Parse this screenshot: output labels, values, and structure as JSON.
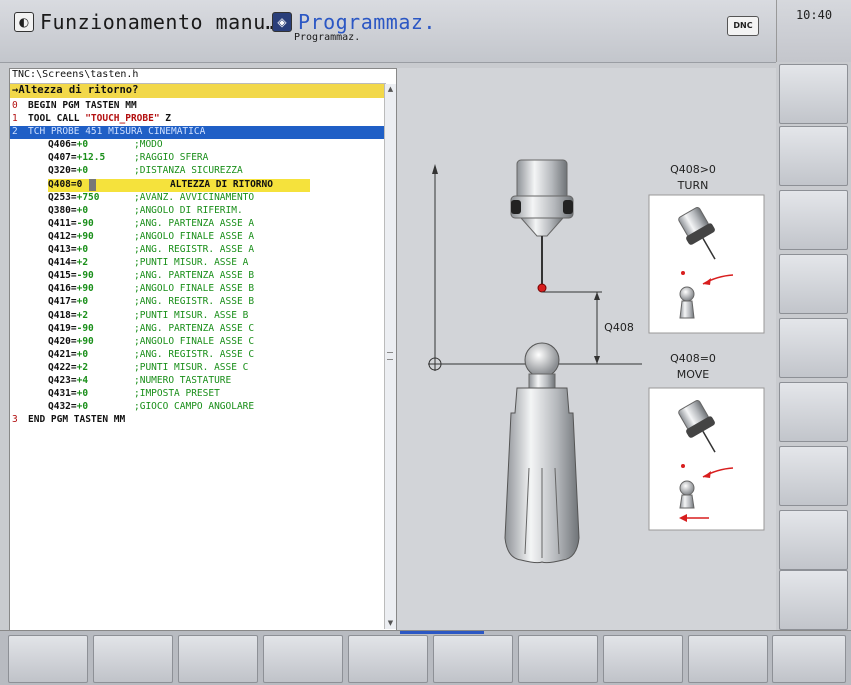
{
  "header": {
    "mode_left_title": "Funzionamento manu…",
    "mode_right_title": "Programmaz.",
    "mode_right_subtitle": "Programmaz.",
    "dnc_label": "DNC",
    "clock": "10:40"
  },
  "editor": {
    "path": "TNC:\\Screens\\tasten.h",
    "prompt": "→Altezza di ritorno?",
    "lines": [
      {
        "num": "0",
        "code": "BEGIN PGM TASTEN MM"
      },
      {
        "num": "1",
        "code": "TOOL CALL ",
        "string": "\"TOUCH_PROBE\"",
        "tail": " Z"
      },
      {
        "num": "2",
        "code": "TCH PROBE 451 MISURA CINEMATICA"
      },
      {
        "param": "Q406=+0",
        "comment": ";MODO"
      },
      {
        "param": "Q407=+12.5",
        "comment": ";RAGGIO SFERA"
      },
      {
        "param": "Q320=+0",
        "comment": ";DISTANZA SICUREZZA"
      },
      {
        "param": "Q408=0",
        "comment": "ALTEZZA DI RITORNO"
      },
      {
        "param": "Q253=+750",
        "comment": ";AVANZ. AVVICINAMENTO"
      },
      {
        "param": "Q380=+0",
        "comment": ";ANGOLO DI RIFERIM."
      },
      {
        "param": "Q411=-90",
        "comment": ";ANG. PARTENZA ASSE A"
      },
      {
        "param": "Q412=+90",
        "comment": ";ANGOLO FINALE ASSE A"
      },
      {
        "param": "Q413=+0",
        "comment": ";ANG. REGISTR. ASSE A"
      },
      {
        "param": "Q414=+2",
        "comment": ";PUNTI MISUR. ASSE A"
      },
      {
        "param": "Q415=-90",
        "comment": ";ANG. PARTENZA ASSE B"
      },
      {
        "param": "Q416=+90",
        "comment": ";ANGOLO FINALE ASSE B"
      },
      {
        "param": "Q417=+0",
        "comment": ";ANG. REGISTR. ASSE B"
      },
      {
        "param": "Q418=+2",
        "comment": ";PUNTI MISUR. ASSE B"
      },
      {
        "param": "Q419=-90",
        "comment": ";ANG. PARTENZA ASSE C"
      },
      {
        "param": "Q420=+90",
        "comment": ";ANGOLO FINALE ASSE C"
      },
      {
        "param": "Q421=+0",
        "comment": ";ANG. REGISTR. ASSE C"
      },
      {
        "param": "Q422=+2",
        "comment": ";PUNTI MISUR. ASSE C"
      },
      {
        "param": "Q423=+4",
        "comment": ";NUMERO TASTATURE"
      },
      {
        "param": "Q431=+0",
        "comment": ";IMPOSTA PRESET"
      },
      {
        "param": "Q432=+0",
        "comment": ";GIOCO CAMPO ANGOLARE"
      },
      {
        "num": "3",
        "code": "END PGM TASTEN MM"
      }
    ]
  },
  "graphic": {
    "dim_label": "Q408",
    "option1_title": "Q408>0",
    "option1_subtitle": "TURN",
    "option2_title": "Q408=0",
    "option2_subtitle": "MOVE"
  },
  "colors": {
    "selected_line": "#1f5fc6",
    "prompt_bar": "#f2d84a",
    "comment_text": "#1a8f1a",
    "block_number": "#b31010",
    "arrow_red": "#d81e1e"
  }
}
